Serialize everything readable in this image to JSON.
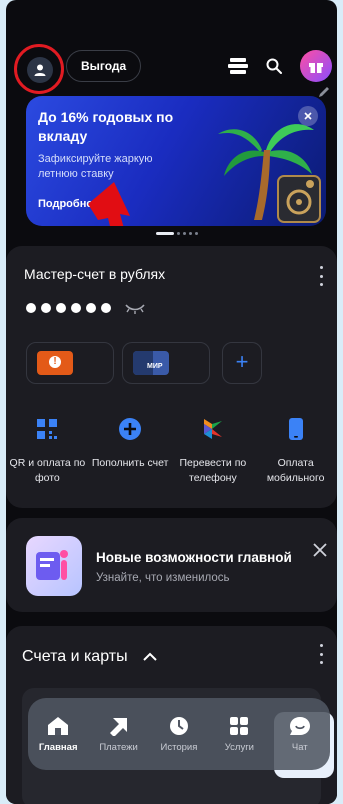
{
  "header": {
    "benefit_label": "Выгода"
  },
  "banner": {
    "title": "До 16% годовых по вкладу",
    "subtitle": "Зафиксируйте жаркую летнюю ставку",
    "more_label": "Подробнее"
  },
  "account_card": {
    "title": "Мастер-счет в рублях",
    "balance_hidden": "●●●●●●",
    "cards": [
      {
        "badge": "!"
      },
      {
        "badge": "МИР"
      }
    ],
    "add_label": "+",
    "actions": [
      {
        "label": "QR и оплата по фото",
        "icon": "qr-icon"
      },
      {
        "label": "Пополнить счет",
        "icon": "plus-circle-icon"
      },
      {
        "label": "Перевести по телефону",
        "icon": "sbp-icon"
      },
      {
        "label": "Оплата мобильного",
        "icon": "phone-icon"
      }
    ]
  },
  "news": {
    "title": "Новые возможности главной",
    "subtitle": "Узнайте, что изменилось"
  },
  "accounts_section": {
    "title": "Счета и карты"
  },
  "bottom_nav": [
    {
      "label": "Главная",
      "icon": "home-icon",
      "active": true
    },
    {
      "label": "Платежи",
      "icon": "payments-icon",
      "active": false
    },
    {
      "label": "История",
      "icon": "history-icon",
      "active": false
    },
    {
      "label": "Услуги",
      "icon": "services-icon",
      "active": false
    },
    {
      "label": "Чат",
      "icon": "chat-icon",
      "active": false
    }
  ],
  "colors": {
    "accent": "#3b82f6",
    "highlight": "#e11b22",
    "background": "#0b0b0f"
  }
}
